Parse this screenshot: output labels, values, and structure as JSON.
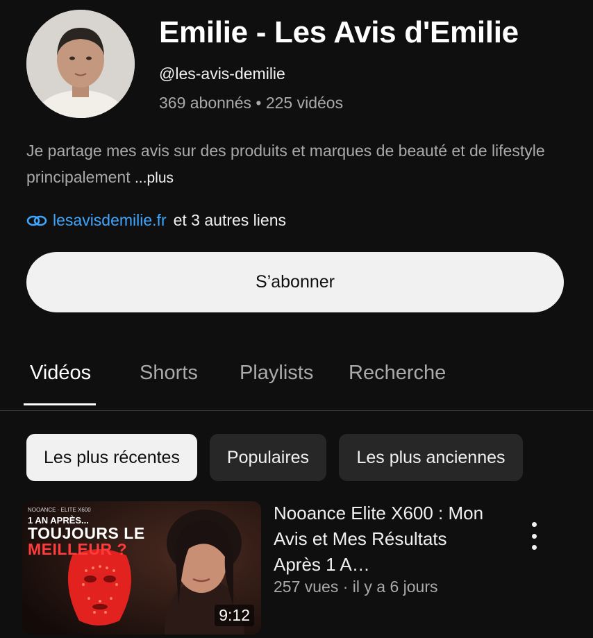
{
  "channel": {
    "title": "Emilie - Les Avis d'Emilie",
    "handle": "@les-avis-demilie",
    "meta": "369 abonnés • 225 vidéos",
    "description": "Je partage mes avis sur des produits et marques de beauté et de lifestyle principalement ",
    "more_label": "...plus",
    "link_url": "lesavisdemilie.fr",
    "link_more": "et 3 autres liens",
    "subscribe_label": "S’abonner"
  },
  "tabs": [
    {
      "label": "Vidéos",
      "active": true
    },
    {
      "label": "Shorts",
      "active": false
    },
    {
      "label": "Playlists",
      "active": false
    },
    {
      "label": "Recherche",
      "active": false
    }
  ],
  "filters": [
    {
      "label": "Les plus récentes",
      "active": true
    },
    {
      "label": "Populaires",
      "active": false
    },
    {
      "label": "Les plus anciennes",
      "active": false
    }
  ],
  "videos": [
    {
      "title": "Nooance Elite X600 : Mon Avis et Mes Résultats Après 1 A…",
      "meta": "257 vues · il y a 6 jours",
      "duration": "9:12",
      "thumb_brand": "NOOANCE · ELITE X600",
      "thumb_line1": "1 AN APRÈS...",
      "thumb_line2": "TOUJOURS LE",
      "thumb_line3": "MEILLEUR ?"
    }
  ],
  "icons": {
    "link": "link-icon",
    "more": "more-vert-icon"
  },
  "colors": {
    "background": "#0f0f0f",
    "link": "#3ea6ff",
    "chip_active_bg": "#f1f1f1",
    "chip_bg": "#272727"
  }
}
